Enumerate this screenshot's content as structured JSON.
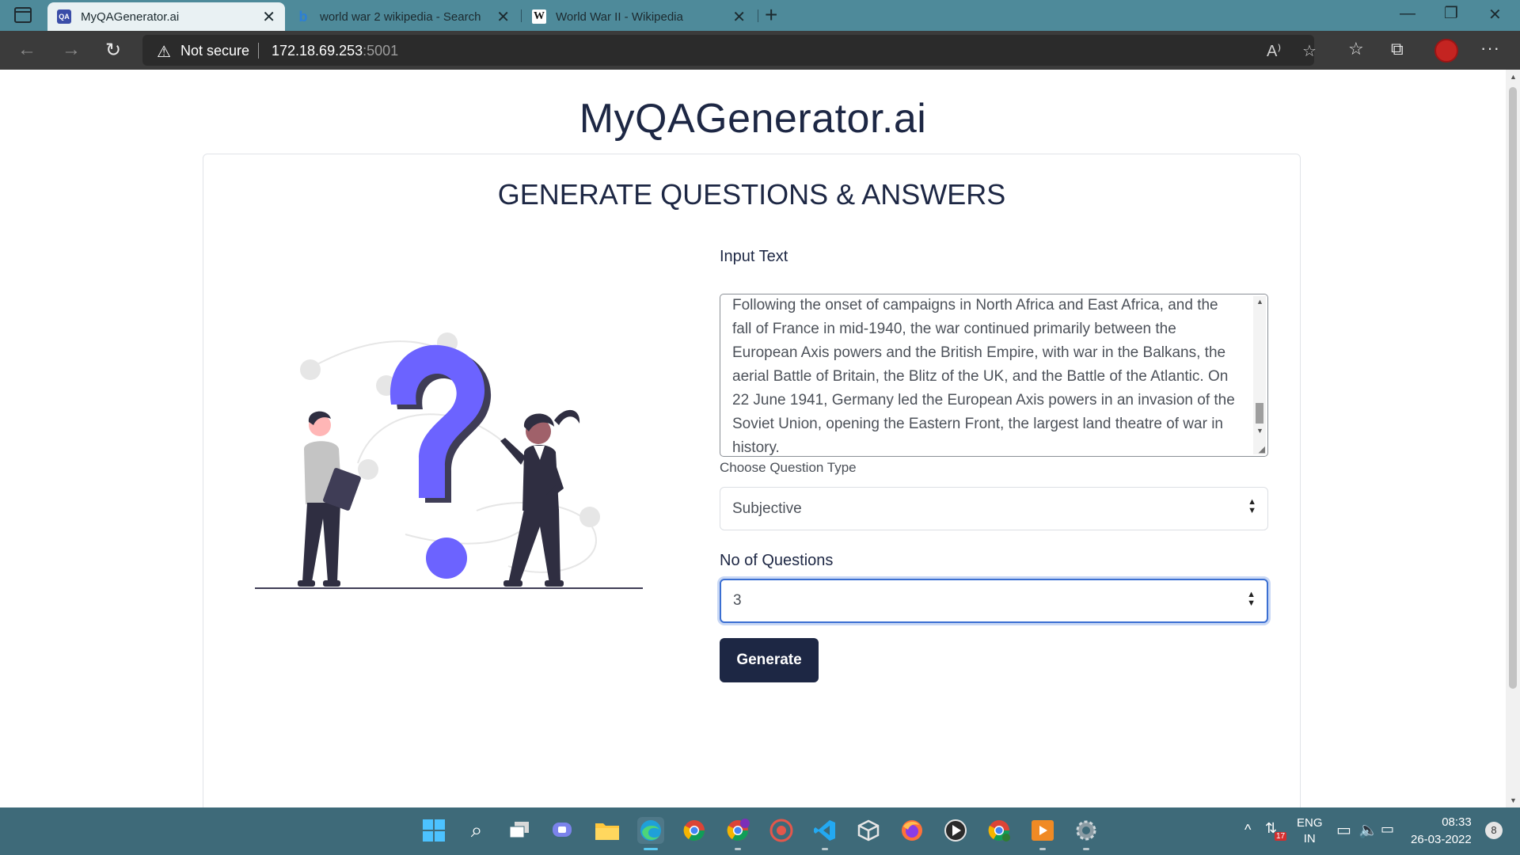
{
  "browser": {
    "tabs": [
      {
        "title": "MyQAGenerator.ai",
        "active": true
      },
      {
        "title": "world war 2 wikipedia - Search",
        "active": false
      },
      {
        "title": "World War II - Wikipedia",
        "active": false
      }
    ],
    "address": {
      "security_label": "Not secure",
      "host": "172.18.69.253",
      "port": ":5001"
    }
  },
  "page": {
    "site_title": "MyQAGenerator.ai",
    "card_title": "GENERATE QUESTIONS & ANSWERS",
    "input_label": "Input Text",
    "input_text": "Following the onset of campaigns in North Africa and East Africa, and the fall of France in mid-1940, the war continued primarily between the European Axis powers and the British Empire, with war in the Balkans, the aerial Battle of Britain, the Blitz of the UK, and the Battle of the Atlantic. On 22 June 1941, Germany led the European Axis powers in an invasion of the Soviet Union, opening the Eastern Front, the largest land theatre of war in history.",
    "question_type_label": "Choose Question Type",
    "question_type_value": "Subjective",
    "num_questions_label": "No of Questions",
    "num_questions_value": "3",
    "generate_label": "Generate"
  },
  "colors": {
    "accent": "#1d2744",
    "illustration_accent": "#6c63ff",
    "focus_border": "#3b6fd2"
  },
  "taskbar": {
    "language": "ENG",
    "region": "IN",
    "time": "08:33",
    "date": "26-03-2022",
    "notifications": "8",
    "wifi_badge": "17"
  }
}
